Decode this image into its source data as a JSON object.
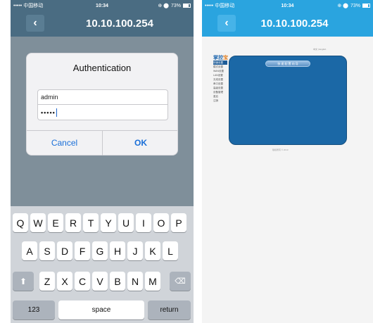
{
  "status_bar": {
    "carrier": "••••• 中国移动",
    "wifi": "ᯤ",
    "time": "10:34",
    "indicators": "⊕ ⬤",
    "battery": "73%"
  },
  "left": {
    "nav_title": "10.10.100.254",
    "back_icon": "chevron-left-icon",
    "dialog": {
      "title": "Authentication",
      "username_value": "admin",
      "password_value": "•••••",
      "cancel_label": "Cancel",
      "ok_label": "OK"
    },
    "keyboard": {
      "row1": [
        "Q",
        "W",
        "E",
        "R",
        "T",
        "Y",
        "U",
        "I",
        "O",
        "P"
      ],
      "row2": [
        "A",
        "S",
        "D",
        "F",
        "G",
        "H",
        "J",
        "K",
        "L"
      ],
      "row3": [
        "Z",
        "X",
        "C",
        "V",
        "B",
        "N",
        "M"
      ],
      "numbers_label": "123",
      "space_label": "space",
      "return_label": "return",
      "shift_icon": "shift-icon",
      "delete_icon": "backspace-icon"
    }
  },
  "right": {
    "nav_title": "10.10.100.254",
    "top_note": "中文 | English",
    "brand_main": "掌控",
    "brand_accent": "宝",
    "menu": [
      "快速设置",
      "模式设置",
      "WAN设置",
      "LAN设置",
      "无线设置",
      "串口设置",
      "高级设置",
      "设备管理",
      "重启",
      "注销"
    ],
    "panel_button": "快 速 配 置 向 导",
    "footer": "版权所有 © 2013"
  },
  "colors": {
    "left_bar": "#4a6c82",
    "right_bar": "#2aa4df",
    "ios_blue": "#1a6fd8",
    "panel": "#1b68a6"
  }
}
